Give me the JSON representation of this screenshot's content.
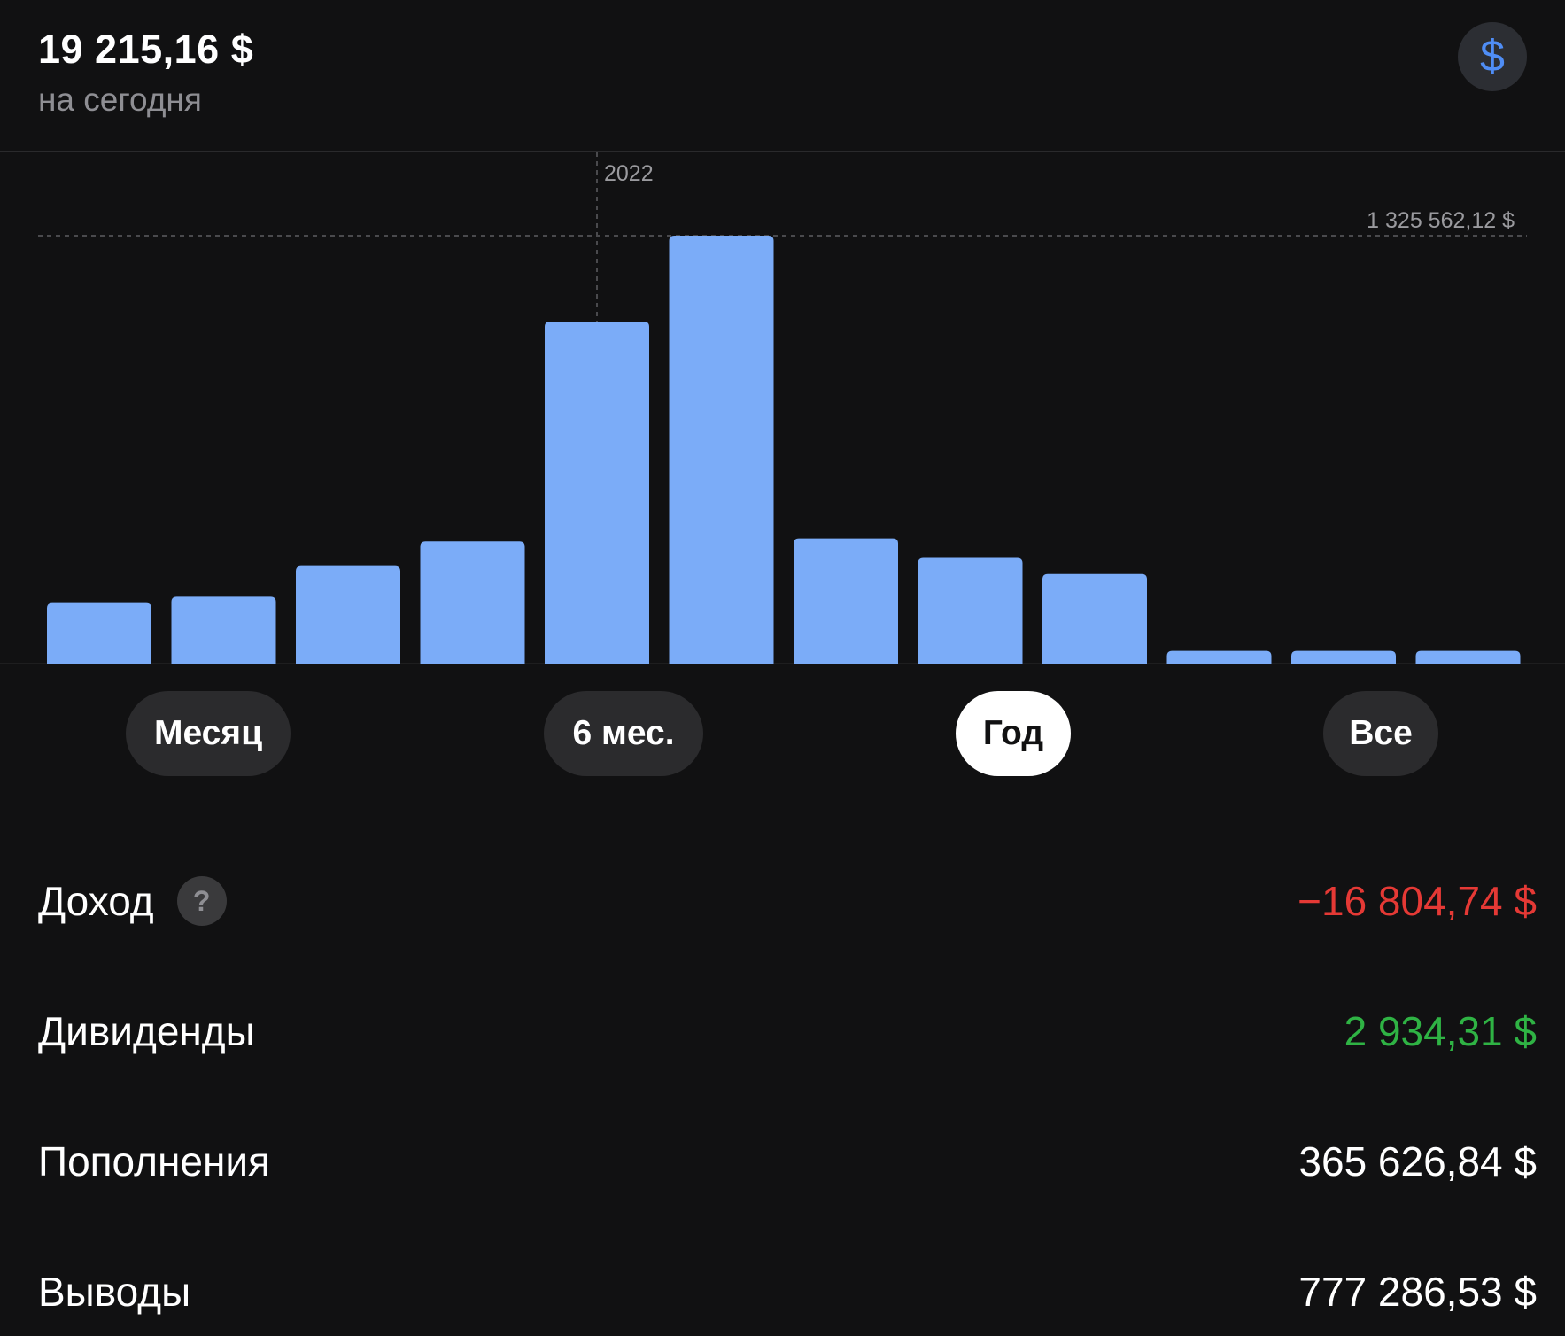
{
  "header": {
    "balance": "19 215,16  $",
    "subtitle": "на сегодня",
    "currency_icon": "dollar-icon",
    "currency_symbol": "$",
    "colors": {
      "accent": "#4f8df5",
      "button_bg": "#2c2e33"
    }
  },
  "chart_data": {
    "type": "bar",
    "values": [
      190000,
      210000,
      305000,
      380000,
      1060000,
      1325562.12,
      390000,
      330000,
      280000,
      42000,
      42000,
      42000
    ],
    "ylim": [
      0,
      1325562.12
    ],
    "max_label": "1 325 562,12 $",
    "marker_label": "2022",
    "marker_index": 4,
    "bar_color": "#7bacf8",
    "grid": false
  },
  "segments": [
    {
      "label": "Месяц",
      "active": false
    },
    {
      "label": "6 мес.",
      "active": false
    },
    {
      "label": "Год",
      "active": true
    },
    {
      "label": "Все",
      "active": false
    }
  ],
  "stats": {
    "income": {
      "label": "Доход",
      "value": "−16 804,74 $",
      "color": "#e53935",
      "help_icon": "question-icon",
      "help_glyph": "?"
    },
    "dividends": {
      "label": "Дивиденды",
      "value": "2 934,31 $",
      "color": "#2fb344"
    },
    "deposits": {
      "label": "Пополнения",
      "value": "365 626,84 $",
      "color": "#ffffff"
    },
    "withdrawals": {
      "label": "Выводы",
      "value": "777 286,53 $",
      "color": "#ffffff"
    }
  }
}
